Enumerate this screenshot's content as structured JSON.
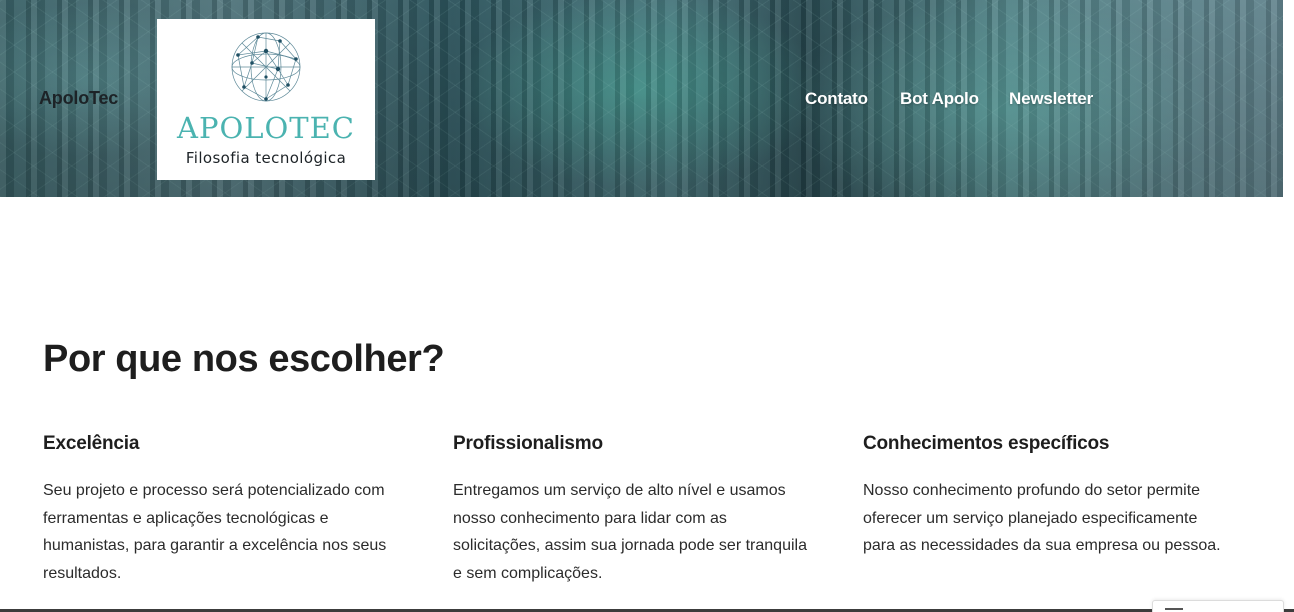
{
  "header": {
    "site_title": "ApoloTec",
    "logo": {
      "brand": "APOLOTEC",
      "tagline": "Filosofia tecnológica",
      "brand_color": "#4bb3b0",
      "icon": "network-globe-icon"
    },
    "nav": [
      {
        "label": "Contato"
      },
      {
        "label": "Bot Apolo"
      },
      {
        "label": "Newsletter"
      }
    ]
  },
  "main": {
    "title": "Por que nos escolher?",
    "features": [
      {
        "title": "Excelência",
        "lines": [
          "Seu projeto e processo será potencializado com",
          "ferramentas e aplicações tecnológicas e",
          "humanistas, para garantir a excelência nos seus",
          "resultados."
        ]
      },
      {
        "title": "Profissionalismo",
        "lines": [
          "Entregamos um serviço de alto nível e usamos",
          "nosso conhecimento para lidar com as",
          "solicitações, assim sua jornada pode ser tranquila",
          "e sem complicações."
        ]
      },
      {
        "title": "Conhecimentos específicos",
        "lines": [
          "Nosso conhecimento profundo do setor permite",
          "oferecer um serviço planejado especificamente",
          "para as necessidades da sua empresa ou pessoa."
        ]
      }
    ]
  }
}
